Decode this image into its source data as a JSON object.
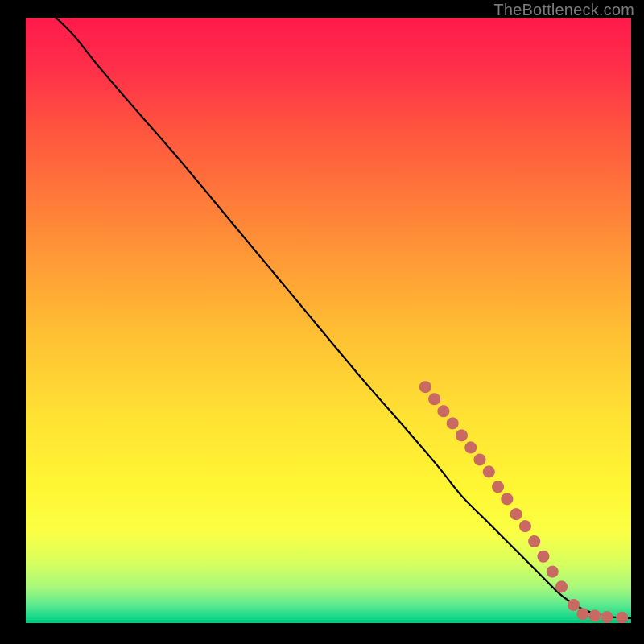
{
  "watermark": "TheBottleneck.com",
  "chart_data": {
    "type": "line",
    "title": "",
    "xlabel": "",
    "ylabel": "",
    "xlim": [
      0,
      100
    ],
    "ylim": [
      0,
      100
    ],
    "series": [
      {
        "name": "curve",
        "x": [
          5,
          8,
          12,
          18,
          25,
          35,
          45,
          55,
          62,
          68,
          72,
          76,
          80,
          84,
          88,
          90,
          92,
          94,
          96,
          98,
          100
        ],
        "y": [
          100,
          97,
          92,
          85,
          77,
          65,
          53,
          41,
          33,
          26,
          21,
          17,
          13,
          9,
          5,
          3.5,
          2.3,
          1.6,
          1.1,
          0.9,
          0.8
        ]
      }
    ],
    "markers": [
      {
        "name": "dots",
        "color": "#c96a62",
        "points": [
          {
            "x": 66,
            "y": 39
          },
          {
            "x": 67.5,
            "y": 37
          },
          {
            "x": 69,
            "y": 35
          },
          {
            "x": 70.5,
            "y": 33
          },
          {
            "x": 72,
            "y": 31
          },
          {
            "x": 73.5,
            "y": 29
          },
          {
            "x": 75,
            "y": 27
          },
          {
            "x": 76.5,
            "y": 25
          },
          {
            "x": 78,
            "y": 22.5
          },
          {
            "x": 79.5,
            "y": 20.5
          },
          {
            "x": 81,
            "y": 18
          },
          {
            "x": 82.5,
            "y": 16
          },
          {
            "x": 84,
            "y": 13.5
          },
          {
            "x": 85.5,
            "y": 11
          },
          {
            "x": 87,
            "y": 8.5
          },
          {
            "x": 88.5,
            "y": 6
          },
          {
            "x": 90.5,
            "y": 3
          },
          {
            "x": 92,
            "y": 1.5
          },
          {
            "x": 94,
            "y": 1.2
          },
          {
            "x": 96,
            "y": 1.0
          },
          {
            "x": 98.5,
            "y": 0.9
          }
        ]
      }
    ]
  }
}
